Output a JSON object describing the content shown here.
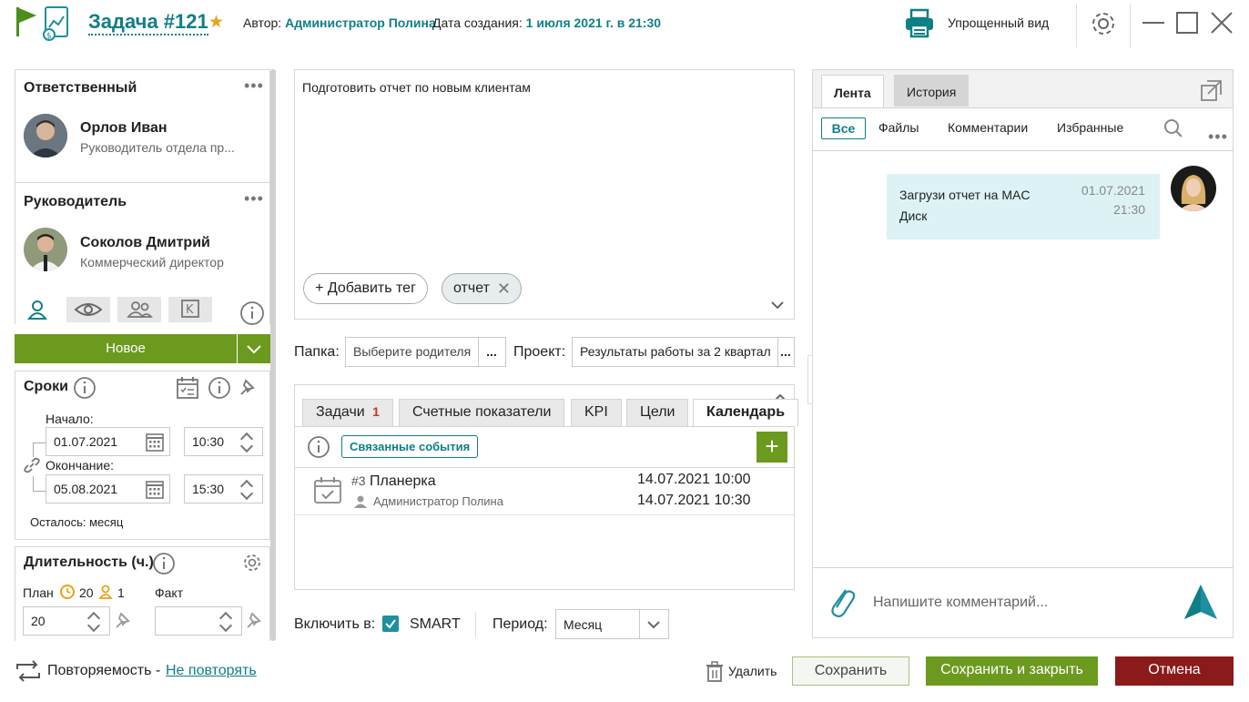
{
  "header": {
    "title": "Задача #121",
    "author_label": "Автор:",
    "author": "Администратор Полина",
    "created_label": "Дата создания:",
    "created": "1 июля 2021 г. в 21:30",
    "simplified_view": "Упрощенный вид"
  },
  "responsible": {
    "title": "Ответственный",
    "name": "Орлов Иван",
    "role": "Руководитель отдела пр..."
  },
  "manager": {
    "title": "Руководитель",
    "name": "Соколов Дмитрий",
    "role": "Коммерческий директор"
  },
  "status": {
    "label": "Новое"
  },
  "deadlines": {
    "title": "Сроки",
    "start_label": "Начало:",
    "start_date": "01.07.2021",
    "start_time": "10:30",
    "end_label": "Окончание:",
    "end_date": "05.08.2021",
    "end_time": "15:30",
    "remaining": "Осталось: месяц"
  },
  "duration": {
    "title": "Длительность (ч.)",
    "plan_label": "План",
    "plan_hours": "20",
    "plan_people": "1",
    "fact_label": "Факт",
    "plan_value": "20",
    "fact_value": ""
  },
  "description": {
    "text": "Подготовить отчет по новым клиентам",
    "add_tag": "+ Добавить тег",
    "tags": [
      "отчет"
    ]
  },
  "folder": {
    "label": "Папка:",
    "value": "Выберите родителя"
  },
  "project": {
    "label": "Проект:",
    "value": "Результаты работы за 2 квартал"
  },
  "tabs": {
    "items": [
      {
        "label": "Задачи",
        "badge": "1"
      },
      {
        "label": "Счетные показатели"
      },
      {
        "label": "KPI"
      },
      {
        "label": "Цели"
      },
      {
        "label": "Календарь"
      }
    ],
    "linked_events": "Связанные события"
  },
  "event": {
    "number": "#3",
    "title": "Планерка",
    "author": "Администратор Полина",
    "start": "14.07.2021 10:00",
    "end": "14.07.2021 10:30"
  },
  "include": {
    "label": "Включить в:",
    "smart": "SMART",
    "period_label": "Период:",
    "period_value": "Месяц"
  },
  "feed": {
    "tabs": [
      "Лента",
      "История"
    ],
    "filters": [
      "Все",
      "Файлы",
      "Комментарии",
      "Избранные"
    ],
    "message": {
      "text_line1": "Загрузи отчет на MAC",
      "text_line2": "Диск",
      "date": "01.07.2021",
      "time": "21:30"
    },
    "comment_placeholder": "Напишите комментарий..."
  },
  "footer": {
    "repeat_label": "Повторяемость -",
    "repeat_value": "Не повторять",
    "delete": "Удалить",
    "save": "Сохранить",
    "save_close": "Сохранить и закрыть",
    "cancel": "Отмена"
  },
  "colors": {
    "accent": "#0f7f86",
    "green": "#6c9a1f",
    "cancel": "#8b1a1a",
    "bubble": "#dcf2f5"
  }
}
